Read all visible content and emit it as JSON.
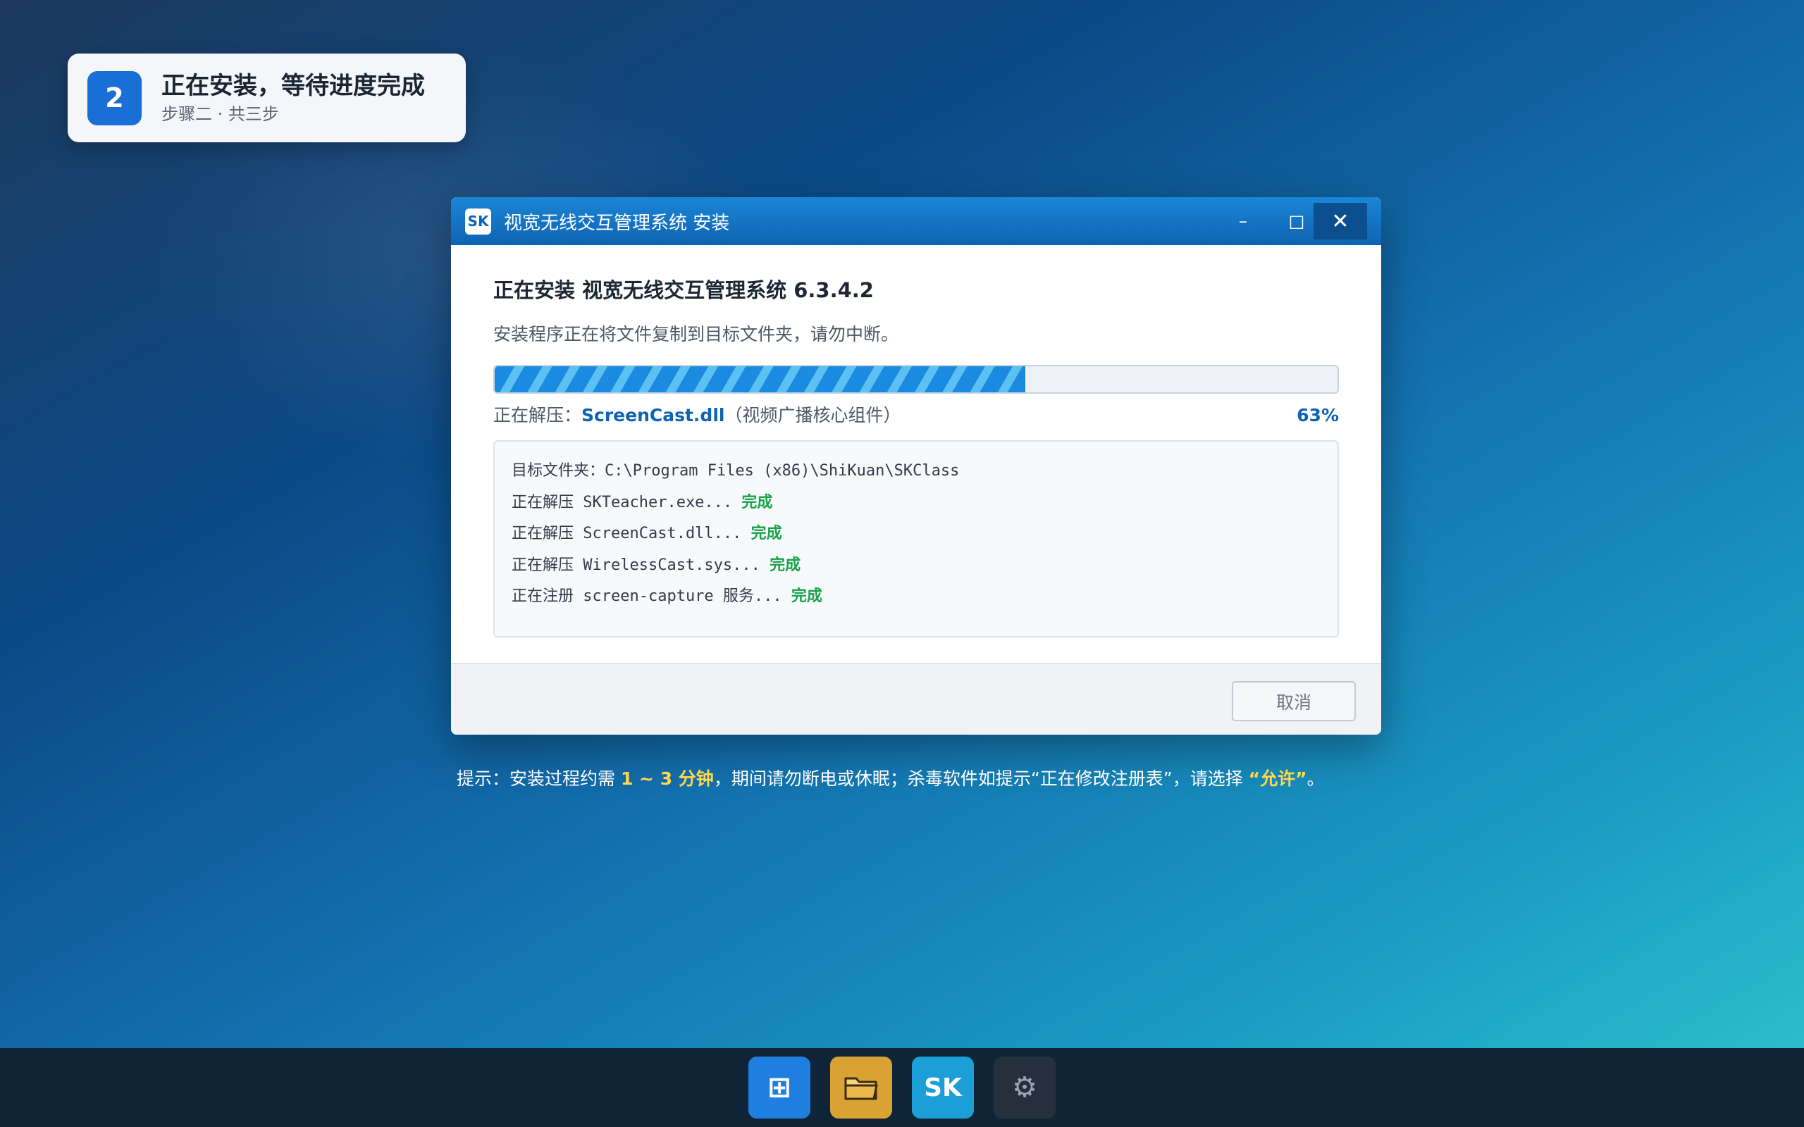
{
  "step": {
    "number": "2",
    "title": "正在安装，等待进度完成",
    "subtitle": "步骤二 · 共三步"
  },
  "window": {
    "badge": "SK",
    "title": "视宽无线交互管理系统 安装",
    "controls": {
      "minimize": "–",
      "maximize": "□",
      "close": "✕"
    }
  },
  "install": {
    "heading": "正在安装 视宽无线交互管理系统 6.3.4.2",
    "description": "安装程序正在将文件复制到目标文件夹，请勿中断。",
    "progress_percent": 63,
    "status_prefix": "正在解压：",
    "status_file": "ScreenCast.dll",
    "status_note": "（视频广播核心组件）",
    "status_percent_label": "63%"
  },
  "log": {
    "lines": [
      {
        "text": "目标文件夹：C:\\Program Files (x86)\\ShiKuan\\SKClass",
        "result": ""
      },
      {
        "text": "正在解压 SKTeacher.exe... ",
        "result": "完成"
      },
      {
        "text": "正在解压 ScreenCast.dll... ",
        "result": "完成"
      },
      {
        "text": "正在解压 WirelessCast.sys... ",
        "result": "完成"
      },
      {
        "text": "正在注册 screen-capture 服务... ",
        "result": "完成"
      }
    ]
  },
  "footer": {
    "cancel_label": "取消"
  },
  "hint": {
    "part1": "提示：安装过程约需 ",
    "highlight1": "1 ~ 3 分钟",
    "part2": "，期间请勿断电或休眠；杀毒软件如提示“正在修改注册表”，请选择 ",
    "highlight2": "“允许”",
    "part3": "。"
  },
  "taskbar": {
    "items": [
      {
        "name": "start",
        "icon": "windows-grid-icon",
        "glyph": "⊞"
      },
      {
        "name": "file-explorer",
        "icon": "folder-icon",
        "glyph": ""
      },
      {
        "name": "skclass",
        "icon": "sk-app-icon",
        "glyph": "SK"
      },
      {
        "name": "settings",
        "icon": "gear-icon",
        "glyph": "⚙"
      }
    ]
  },
  "colors": {
    "accent": "#0f63b3",
    "success": "#16a34a",
    "highlight": "#ffd84a"
  }
}
